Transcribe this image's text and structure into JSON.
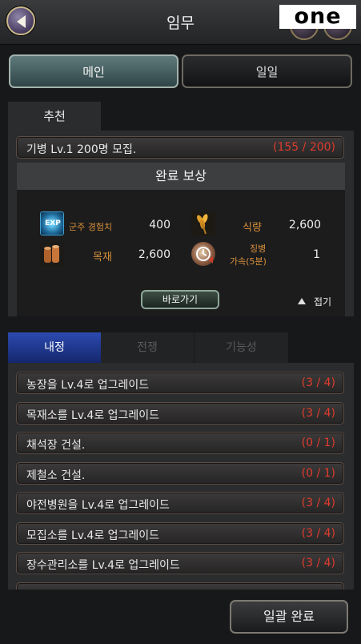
{
  "header": {
    "title": "임무"
  },
  "watermark": "one",
  "top_tabs": [
    {
      "label": "메인",
      "active": true
    },
    {
      "label": "일일",
      "active": false
    }
  ],
  "recommend": {
    "tab_label": "추천",
    "quest": {
      "label": "기병 Lv.1 200명 모집.",
      "progress": "(155 / 200)"
    },
    "reward_title": "완료 보상",
    "rewards": [
      {
        "icon": "exp-icon",
        "icon_text": "EXP",
        "label": "군주 경험치",
        "value": "400"
      },
      {
        "icon": "wheat-icon",
        "label": "식량",
        "value": "2,600"
      },
      {
        "icon": "wood-icon",
        "label": "목재",
        "value": "2,600"
      },
      {
        "icon": "speedup-icon",
        "label_line1": "징병",
        "label_line2": "가속(5분)",
        "value": "1"
      }
    ],
    "goto_label": "바로가기",
    "collapse_label": "접기"
  },
  "category_tabs": [
    {
      "label": "내정",
      "active": true
    },
    {
      "label": "전쟁",
      "active": false
    },
    {
      "label": "기능성",
      "active": false
    }
  ],
  "quests": [
    {
      "label": "농장을 Lv.4로 업그레이드",
      "progress": "(3 / 4)"
    },
    {
      "label": "목재소를 Lv.4로 업그레이드",
      "progress": "(3 / 4)"
    },
    {
      "label": "채석장 건설.",
      "progress": "(0 / 1)"
    },
    {
      "label": "제철소 건설.",
      "progress": "(0 / 1)"
    },
    {
      "label": "야전병원을 Lv.4로 업그레이드",
      "progress": "(3 / 4)"
    },
    {
      "label": "모집소를 Lv.4로 업그레이드",
      "progress": "(3 / 4)"
    },
    {
      "label": "장수관리소를 Lv.4로 업그레이드",
      "progress": "(3 / 4)"
    },
    {
      "label": "",
      "progress": ""
    }
  ],
  "bottom_button": "일괄 완료",
  "colors": {
    "progress": "#e03b2e",
    "reward_label": "#d9913a",
    "active_tab": "#2c4ab0"
  }
}
